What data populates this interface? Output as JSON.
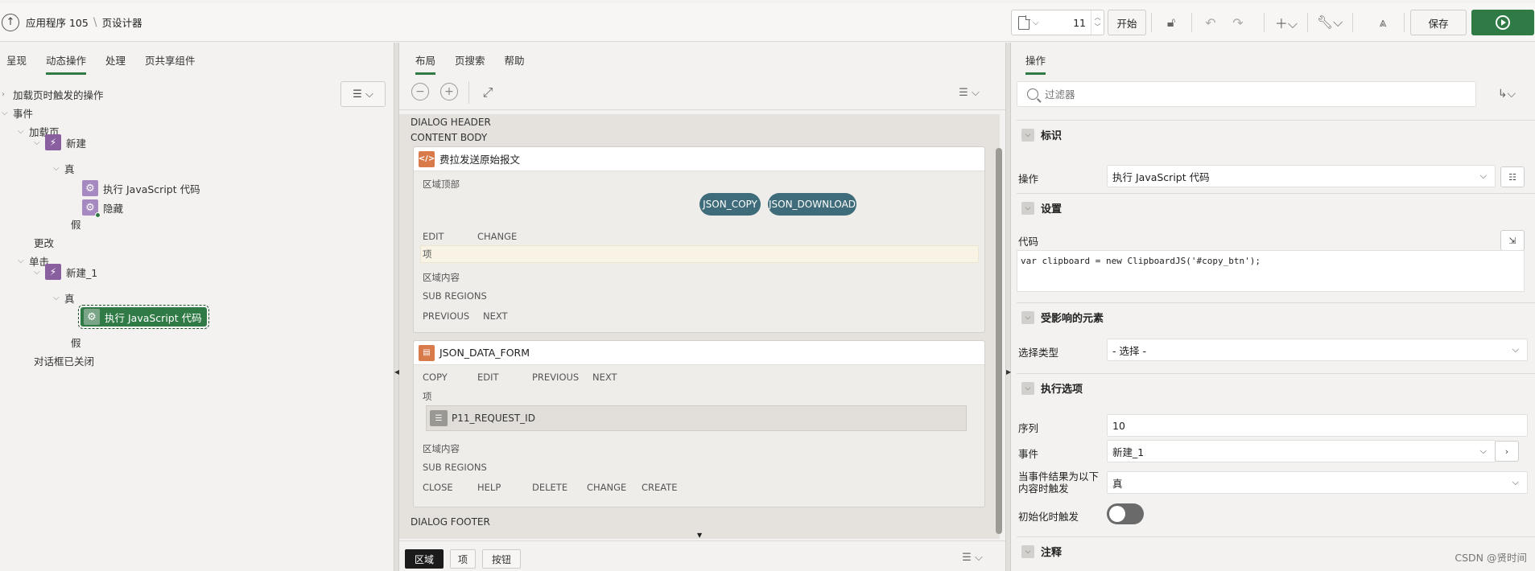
{
  "header": {
    "app_name": "应用程序 105",
    "separator": "\\",
    "page_designer": "页设计器",
    "page_number": "11",
    "go_label": "开始",
    "save_label": "保存"
  },
  "left": {
    "tabs": [
      "呈现",
      "动态操作",
      "处理",
      "页共享组件"
    ],
    "active_tab": 1,
    "tree": {
      "on_load_actions": "加载页时触发的操作",
      "events": "事件",
      "page_load": "加载页",
      "da1": "新建",
      "true1": "真",
      "act1": "执行 JavaScript 代码",
      "act2": "隐藏",
      "false1": "假",
      "change": "更改",
      "click": "单击",
      "da2": "新建_1",
      "true2": "真",
      "act3": "执行 JavaScript 代码",
      "false2": "假",
      "dialog_closed": "对话框已关闭"
    }
  },
  "center": {
    "tabs": [
      "布局",
      "页搜索",
      "帮助"
    ],
    "active_tab": 0,
    "dialog_header": "DIALOG HEADER",
    "content_body": "CONTENT BODY",
    "dialog_footer": "DIALOG FOOTER",
    "region1": {
      "title": "费拉发送原始报文",
      "top_label": "区域顶部",
      "btn1": "JSON_COPY",
      "btn2": "JSON_DOWNLOAD",
      "pos1": "EDIT",
      "pos2": "CHANGE",
      "items": "项",
      "content": "区域内容",
      "sub_regions": "SUB REGIONS",
      "prev": "PREVIOUS",
      "next": "NEXT"
    },
    "region2": {
      "title": "JSON_DATA_FORM",
      "pos_copy": "COPY",
      "pos_edit": "EDIT",
      "pos_prev": "PREVIOUS",
      "pos_next": "NEXT",
      "items": "项",
      "field": "P11_REQUEST_ID",
      "content": "区域内容",
      "sub_regions": "SUB REGIONS",
      "close": "CLOSE",
      "help": "HELP",
      "delete": "DELETE",
      "change": "CHANGE",
      "create": "CREATE"
    },
    "bottom_tabs": [
      "区域",
      "项",
      "按钮"
    ]
  },
  "right": {
    "tab": "操作",
    "filter_placeholder": "过滤器",
    "sec_identification": "标识",
    "action_label": "操作",
    "action_value": "执行 JavaScript 代码",
    "sec_settings": "设置",
    "code_label": "代码",
    "code_value": "var clipboard = new ClipboardJS('#copy_btn');",
    "sec_affected": "受影响的元素",
    "selection_type_label": "选择类型",
    "selection_type_value": "- 选择 -",
    "sec_execution": "执行选项",
    "sequence_label": "序列",
    "sequence_value": "10",
    "event_label": "事件",
    "event_value": "新建_1",
    "fire_when_label_1": "当事件结果为以下",
    "fire_when_label_2": "内容时触发",
    "fire_when_value": "真",
    "fire_on_init_label": "初始化时触发",
    "sec_comments": "注释"
  },
  "watermark": "CSDN @贤时间"
}
